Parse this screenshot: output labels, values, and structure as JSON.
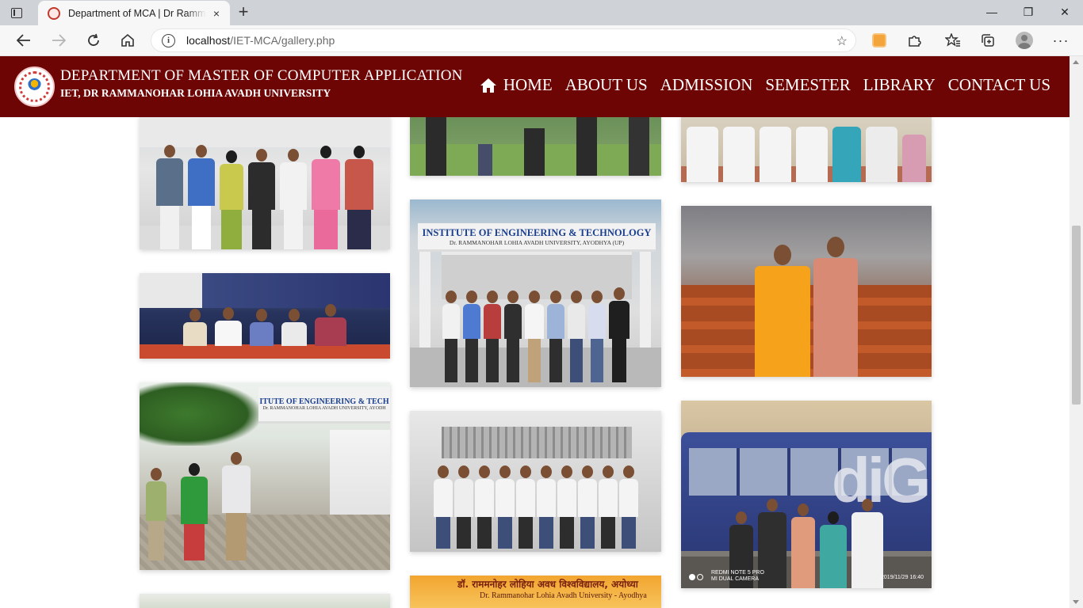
{
  "browser": {
    "tab_title": "Department of MCA | Dr Rammanohar Lohia Avadh University",
    "tab_close": "×",
    "new_tab": "+",
    "url_host": "localhost",
    "url_path": "/IET-MCA/gallery.php",
    "window_controls": [
      "—",
      "❐",
      "✕"
    ]
  },
  "site": {
    "title": "DEPARTMENT OF MASTER OF COMPUTER APPLICATION",
    "subtitle": "IET, DR RAMMANOHAR LOHIA AVADH UNIVERSITY",
    "nav": [
      "HOME",
      "ABOUT US",
      "ADMISSION",
      "SEMESTER",
      "LIBRARY",
      "CONTACT US"
    ]
  },
  "gallery": {
    "institute_sign": "INSTITUTE OF ENGINEERING & TECHNOLOGY",
    "institute_sign_sub": "Dr. RAMMANOHAR LOHIA AVADH UNIVERSITY, AYODHYA (UP)",
    "institute_sign_short": "ITUTE OF ENGINEERING & TECH",
    "institute_sign_short_sub": "Dr. RAMMANOHAR LOHIA AVADH UNIVERSITY, AYODH",
    "banner_hindi": "डॉ. राममनोहर लोहिया अवध विश्वविद्यालय, अयोध्या",
    "banner_english": "Dr. Rammanohar Lohia Avadh University - Ayodhya",
    "phone_stamp_model": "REDMI NOTE 5 PRO",
    "phone_stamp_camera": "MI DUAL CAMERA",
    "phone_stamp_time": "2019/11/29  16:40",
    "bus_text": "diG"
  },
  "colors": {
    "header_bg": "#6d0505",
    "text_on_header": "#ffffff"
  }
}
